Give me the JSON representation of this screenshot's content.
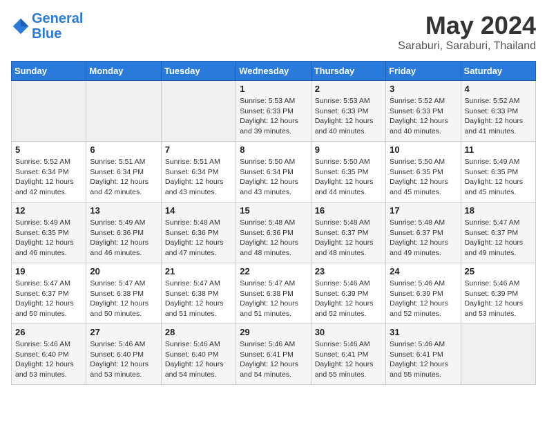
{
  "logo": {
    "line1": "General",
    "line2": "Blue"
  },
  "title": "May 2024",
  "location": "Saraburi, Saraburi, Thailand",
  "weekdays": [
    "Sunday",
    "Monday",
    "Tuesday",
    "Wednesday",
    "Thursday",
    "Friday",
    "Saturday"
  ],
  "weeks": [
    [
      {
        "day": "",
        "info": ""
      },
      {
        "day": "",
        "info": ""
      },
      {
        "day": "",
        "info": ""
      },
      {
        "day": "1",
        "info": "Sunrise: 5:53 AM\nSunset: 6:33 PM\nDaylight: 12 hours\nand 39 minutes."
      },
      {
        "day": "2",
        "info": "Sunrise: 5:53 AM\nSunset: 6:33 PM\nDaylight: 12 hours\nand 40 minutes."
      },
      {
        "day": "3",
        "info": "Sunrise: 5:52 AM\nSunset: 6:33 PM\nDaylight: 12 hours\nand 40 minutes."
      },
      {
        "day": "4",
        "info": "Sunrise: 5:52 AM\nSunset: 6:33 PM\nDaylight: 12 hours\nand 41 minutes."
      }
    ],
    [
      {
        "day": "5",
        "info": "Sunrise: 5:52 AM\nSunset: 6:34 PM\nDaylight: 12 hours\nand 42 minutes."
      },
      {
        "day": "6",
        "info": "Sunrise: 5:51 AM\nSunset: 6:34 PM\nDaylight: 12 hours\nand 42 minutes."
      },
      {
        "day": "7",
        "info": "Sunrise: 5:51 AM\nSunset: 6:34 PM\nDaylight: 12 hours\nand 43 minutes."
      },
      {
        "day": "8",
        "info": "Sunrise: 5:50 AM\nSunset: 6:34 PM\nDaylight: 12 hours\nand 43 minutes."
      },
      {
        "day": "9",
        "info": "Sunrise: 5:50 AM\nSunset: 6:35 PM\nDaylight: 12 hours\nand 44 minutes."
      },
      {
        "day": "10",
        "info": "Sunrise: 5:50 AM\nSunset: 6:35 PM\nDaylight: 12 hours\nand 45 minutes."
      },
      {
        "day": "11",
        "info": "Sunrise: 5:49 AM\nSunset: 6:35 PM\nDaylight: 12 hours\nand 45 minutes."
      }
    ],
    [
      {
        "day": "12",
        "info": "Sunrise: 5:49 AM\nSunset: 6:35 PM\nDaylight: 12 hours\nand 46 minutes."
      },
      {
        "day": "13",
        "info": "Sunrise: 5:49 AM\nSunset: 6:36 PM\nDaylight: 12 hours\nand 46 minutes."
      },
      {
        "day": "14",
        "info": "Sunrise: 5:48 AM\nSunset: 6:36 PM\nDaylight: 12 hours\nand 47 minutes."
      },
      {
        "day": "15",
        "info": "Sunrise: 5:48 AM\nSunset: 6:36 PM\nDaylight: 12 hours\nand 48 minutes."
      },
      {
        "day": "16",
        "info": "Sunrise: 5:48 AM\nSunset: 6:37 PM\nDaylight: 12 hours\nand 48 minutes."
      },
      {
        "day": "17",
        "info": "Sunrise: 5:48 AM\nSunset: 6:37 PM\nDaylight: 12 hours\nand 49 minutes."
      },
      {
        "day": "18",
        "info": "Sunrise: 5:47 AM\nSunset: 6:37 PM\nDaylight: 12 hours\nand 49 minutes."
      }
    ],
    [
      {
        "day": "19",
        "info": "Sunrise: 5:47 AM\nSunset: 6:37 PM\nDaylight: 12 hours\nand 50 minutes."
      },
      {
        "day": "20",
        "info": "Sunrise: 5:47 AM\nSunset: 6:38 PM\nDaylight: 12 hours\nand 50 minutes."
      },
      {
        "day": "21",
        "info": "Sunrise: 5:47 AM\nSunset: 6:38 PM\nDaylight: 12 hours\nand 51 minutes."
      },
      {
        "day": "22",
        "info": "Sunrise: 5:47 AM\nSunset: 6:38 PM\nDaylight: 12 hours\nand 51 minutes."
      },
      {
        "day": "23",
        "info": "Sunrise: 5:46 AM\nSunset: 6:39 PM\nDaylight: 12 hours\nand 52 minutes."
      },
      {
        "day": "24",
        "info": "Sunrise: 5:46 AM\nSunset: 6:39 PM\nDaylight: 12 hours\nand 52 minutes."
      },
      {
        "day": "25",
        "info": "Sunrise: 5:46 AM\nSunset: 6:39 PM\nDaylight: 12 hours\nand 53 minutes."
      }
    ],
    [
      {
        "day": "26",
        "info": "Sunrise: 5:46 AM\nSunset: 6:40 PM\nDaylight: 12 hours\nand 53 minutes."
      },
      {
        "day": "27",
        "info": "Sunrise: 5:46 AM\nSunset: 6:40 PM\nDaylight: 12 hours\nand 53 minutes."
      },
      {
        "day": "28",
        "info": "Sunrise: 5:46 AM\nSunset: 6:40 PM\nDaylight: 12 hours\nand 54 minutes."
      },
      {
        "day": "29",
        "info": "Sunrise: 5:46 AM\nSunset: 6:41 PM\nDaylight: 12 hours\nand 54 minutes."
      },
      {
        "day": "30",
        "info": "Sunrise: 5:46 AM\nSunset: 6:41 PM\nDaylight: 12 hours\nand 55 minutes."
      },
      {
        "day": "31",
        "info": "Sunrise: 5:46 AM\nSunset: 6:41 PM\nDaylight: 12 hours\nand 55 minutes."
      },
      {
        "day": "",
        "info": ""
      }
    ]
  ]
}
